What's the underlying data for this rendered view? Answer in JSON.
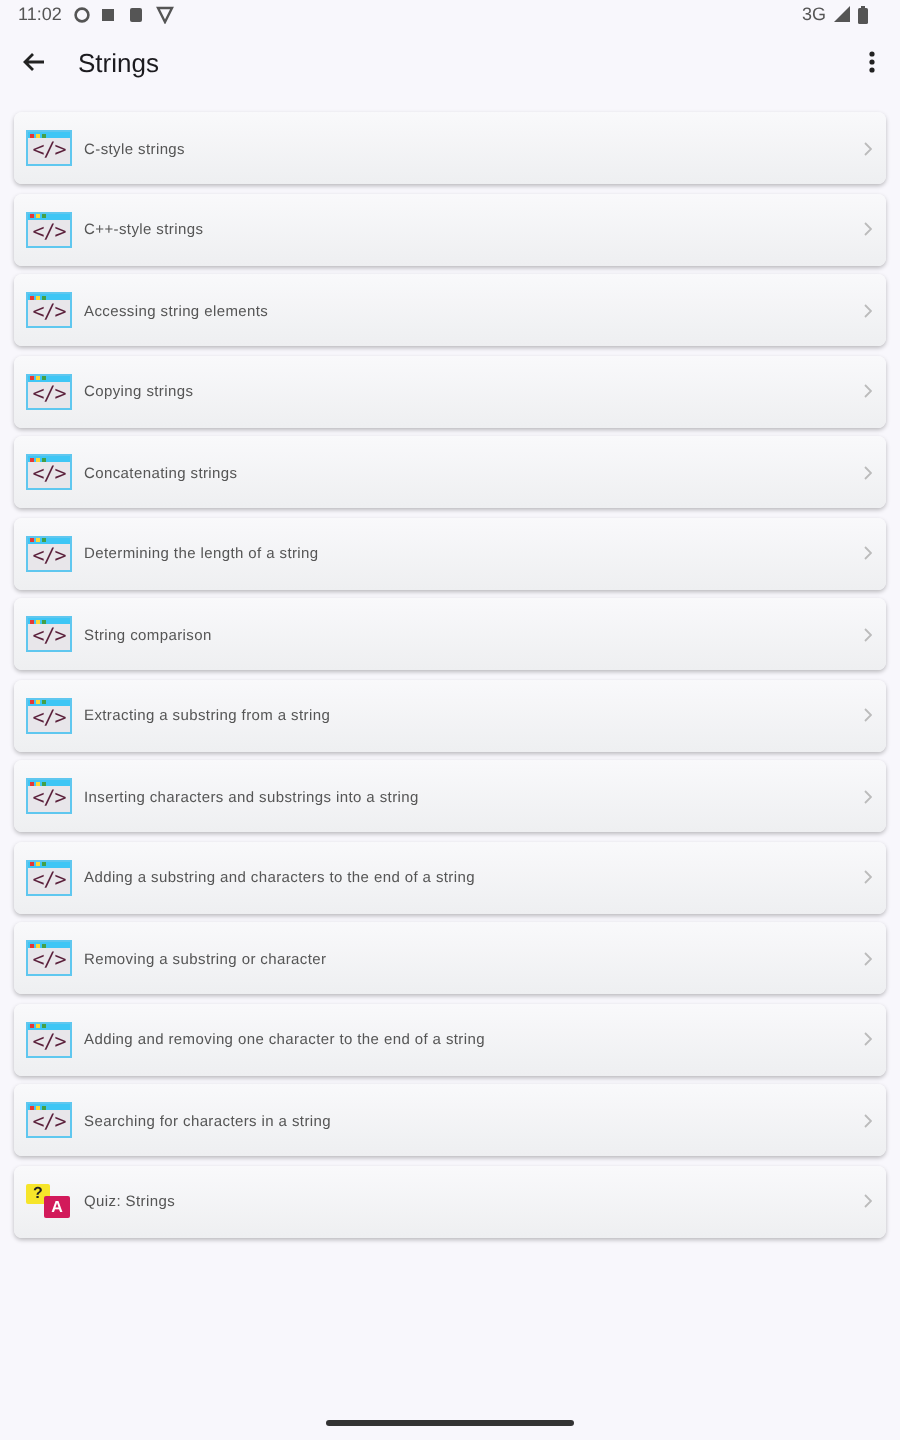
{
  "status_bar": {
    "time": "11:02",
    "network": "3G"
  },
  "app_bar": {
    "title": "Strings"
  },
  "items": [
    {
      "kind": "code",
      "icon_text": "</>",
      "label": "C-style strings"
    },
    {
      "kind": "code",
      "icon_text": "</>",
      "label": "C++-style strings"
    },
    {
      "kind": "code",
      "icon_text": "</>",
      "label": "Accessing string elements"
    },
    {
      "kind": "code",
      "icon_text": "</>",
      "label": "Copying strings"
    },
    {
      "kind": "code",
      "icon_text": "</>",
      "label": "Concatenating strings"
    },
    {
      "kind": "code",
      "icon_text": "</>",
      "label": "Determining the length of a string"
    },
    {
      "kind": "code",
      "icon_text": "</>",
      "label": "String comparison"
    },
    {
      "kind": "code",
      "icon_text": "</>",
      "label": "Extracting a substring from a string"
    },
    {
      "kind": "code",
      "icon_text": "</>",
      "label": "Inserting characters and substrings into a string"
    },
    {
      "kind": "code",
      "icon_text": "</>",
      "label": "Adding a substring and characters to the end of a string"
    },
    {
      "kind": "code",
      "icon_text": "</>",
      "label": "Removing a substring or character"
    },
    {
      "kind": "code",
      "icon_text": "</>",
      "label": "Adding and removing one character to the end of a string"
    },
    {
      "kind": "code",
      "icon_text": "</>",
      "label": "Searching for characters in a string"
    },
    {
      "kind": "quiz",
      "icon_marks": [
        "?",
        "A"
      ],
      "label": "Quiz: Strings"
    }
  ]
}
